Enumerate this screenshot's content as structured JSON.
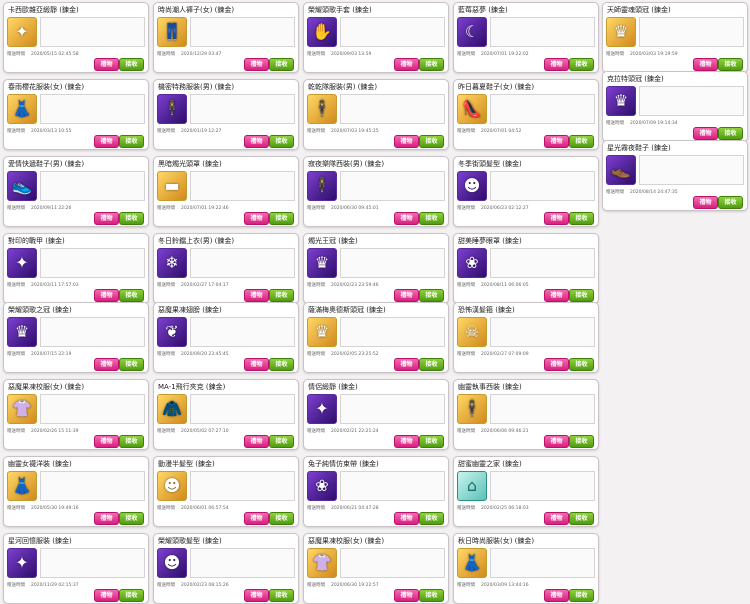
{
  "meta_label": "贈送時間",
  "buttons": {
    "gift": "禮物",
    "receive": "接收"
  },
  "columns": [
    [
      {
        "title": "卡西歐雜亞緞靜 (鍊金)",
        "date": "2020/05/15 02:45:58",
        "icon": "ring-icon",
        "color": "gold",
        "glyph": "✦"
      },
      {
        "title": "春雨櫻花服裝(女) (鍊金)",
        "date": "2020/03/13 10:55",
        "icon": "dress-icon",
        "color": "gold",
        "glyph": "👗"
      },
      {
        "title": "愛情快遞鞋子(男) (鍊金)",
        "date": "2020/09/11 22:26",
        "icon": "shoes-icon",
        "color": "purple",
        "glyph": "👟"
      },
      {
        "title": "對印的戰甲 (鍊金)",
        "date": "2020/03/11 17:57:03",
        "icon": "armor-icon",
        "color": "purple",
        "glyph": "✦"
      },
      {
        "title": "榮耀頭歌之冠 (鍊金)",
        "date": "2020/07/15 22:19",
        "icon": "crown-icon",
        "color": "purple",
        "glyph": "♛"
      },
      {
        "title": "惡魔果凍校服(女) (鍊金)",
        "date": "2020/02/26 15 11:39",
        "icon": "uniform-icon",
        "color": "gold",
        "glyph": "👚"
      },
      {
        "title": "幽靈女襪洋裝 (鍊金)",
        "date": "2020/05/30 19:49:16",
        "icon": "dress-icon",
        "color": "gold",
        "glyph": "👗"
      },
      {
        "title": "星河回憶服裝 (鍊金)",
        "date": "2020/11/29 02:15:37",
        "icon": "outfit-icon",
        "color": "purple",
        "glyph": "✦"
      }
    ],
    [
      {
        "title": "時尚潮人褲子(女) (鍊金)",
        "date": "2020/12/29 03:47",
        "icon": "pants-icon",
        "color": "gold",
        "glyph": "👖"
      },
      {
        "title": "機密特務服裝(男) (鍊金)",
        "date": "2020/01/19 12:27",
        "icon": "suit-icon",
        "color": "purple",
        "glyph": "🕴"
      },
      {
        "title": "黑暗燭光頭罩 (鍊金)",
        "date": "2020/07/01 19:22:46",
        "icon": "headband-icon",
        "color": "gold",
        "glyph": "▬"
      },
      {
        "title": "冬日鈴鐺上衣(男) (鍊金)",
        "date": "2020/02/27 17:04:17",
        "icon": "jacket-icon",
        "color": "purple",
        "glyph": "❄"
      },
      {
        "title": "惡魔果凍翅膀 (鍊金)",
        "date": "2020/09/20 23:45:45",
        "icon": "wings-icon",
        "color": "purple",
        "glyph": "❦"
      },
      {
        "title": "MA-1飛行夾克 (鍊金)",
        "date": "2020/05/02 07:27:10",
        "icon": "jacket-icon",
        "color": "gold",
        "glyph": "🧥"
      },
      {
        "title": "動漫半髮型 (鍊金)",
        "date": "2020/06/01 06:57:54",
        "icon": "hair-icon",
        "color": "gold",
        "glyph": "☻"
      },
      {
        "title": "榮耀頭歌髮型 (鍊金)",
        "date": "2020/02/23 08:15:26",
        "icon": "hair-icon",
        "color": "purple",
        "glyph": "☻"
      }
    ],
    [
      {
        "title": "榮耀頭歌手套 (鍊金)",
        "date": "2020/09/03 13:59",
        "icon": "gloves-icon",
        "color": "purple",
        "glyph": "✋"
      },
      {
        "title": "乾乾隊服裝(男) (鍊金)",
        "date": "2020/07/03 19:45:25",
        "icon": "suit-icon",
        "color": "gold",
        "glyph": "🕴"
      },
      {
        "title": "寂夜樂隊西裝(男) (鍊金)",
        "date": "2020/06/30 09:45:01",
        "icon": "suit-icon",
        "color": "purple",
        "glyph": "🕴"
      },
      {
        "title": "燭光王冠 (鍊金)",
        "date": "2020/02/23 23:59:46",
        "icon": "crown-icon",
        "color": "purple",
        "glyph": "♛"
      },
      {
        "title": "薩滿梅奧德斯頭冠 (鍊金)",
        "date": "2020/02/05 23:25:52",
        "icon": "crown-icon",
        "color": "gold",
        "glyph": "♛"
      },
      {
        "title": "情侶緞靜 (鍊金)",
        "date": "2020/02/21 22:21:24",
        "icon": "ring-icon",
        "color": "purple",
        "glyph": "✦"
      },
      {
        "title": "兔子純情仿束帶 (鍊金)",
        "date": "2020/06/21 04:47:28",
        "icon": "ribbon-icon",
        "color": "purple",
        "glyph": "❀"
      },
      {
        "title": "惡魔果凍校服(女) (鍊金)",
        "date": "2020/06/30 19:22:57",
        "icon": "uniform-icon",
        "color": "gold",
        "glyph": "👚"
      }
    ],
    [
      {
        "title": "藍莓惡夢 (鍊金)",
        "date": "2020/07/01 19:22:02",
        "icon": "mask-icon",
        "color": "purple",
        "glyph": "☾"
      },
      {
        "title": "昨日暮夏鞋子(女) (鍊金)",
        "date": "2020/07/01 04:52",
        "icon": "shoes-icon",
        "color": "gold",
        "glyph": "👠"
      },
      {
        "title": "冬季街頭髮型 (鍊金)",
        "date": "2020/06/23 02:12:27",
        "icon": "hair-icon",
        "color": "purple",
        "glyph": "☻"
      },
      {
        "title": "甜美睡夢眼罩 (鍊金)",
        "date": "2020/08/11 06:06:05",
        "icon": "bunny-mask-icon",
        "color": "purple",
        "glyph": "❀"
      },
      {
        "title": "恐怖漢髮箍 (鍊金)",
        "date": "2020/02/27 07:09:09",
        "icon": "headband-icon",
        "color": "gold",
        "glyph": "☠"
      },
      {
        "title": "幽靈執事西裝 (鍊金)",
        "date": "2020/06/06 09:46:21",
        "icon": "suit-icon",
        "color": "gold",
        "glyph": "🕴"
      },
      {
        "title": "甜蜜幽靈之家 (鍊金)",
        "date": "2020/02/25 06:18:03",
        "icon": "house-icon",
        "color": "teal",
        "glyph": "⌂"
      },
      {
        "title": "秋日時尚服裝(女) (鍊金)",
        "date": "2020/03/09 13:44:16",
        "icon": "outfit-icon",
        "color": "gold",
        "glyph": "👗"
      }
    ],
    [
      {
        "title": "天師靈魂頭冠 (鍊金)",
        "date": "2020/03/03 19:19:59",
        "icon": "crown-icon",
        "color": "gold",
        "glyph": "♛"
      },
      {
        "title": "克拉特頭冠 (鍊金)",
        "date": "2020/07/09 19:14:34",
        "icon": "crown-icon",
        "color": "purple",
        "glyph": "♛"
      },
      {
        "title": "星光霧夜鞋子 (鍊金)",
        "date": "2020/08/14 24:47:35",
        "icon": "shoes-icon",
        "color": "purple",
        "glyph": "👞"
      }
    ]
  ]
}
